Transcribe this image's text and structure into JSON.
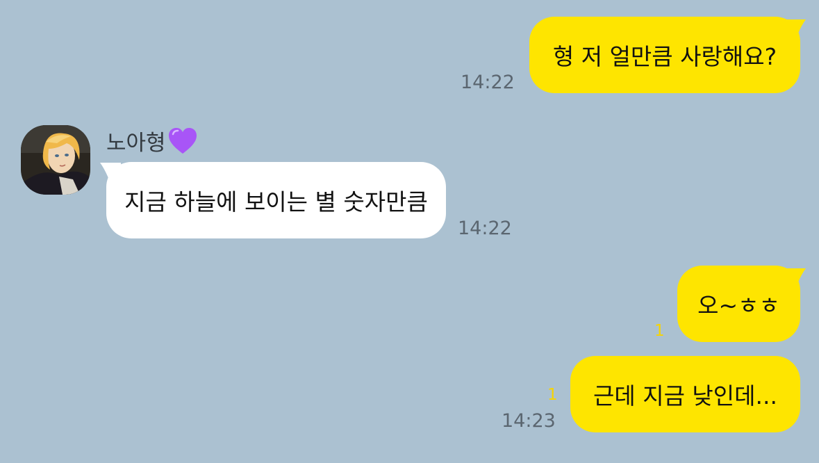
{
  "colors": {
    "background": "#abc1d1",
    "my_bubble": "#fee500",
    "their_bubble": "#ffffff",
    "timestamp": "#5b6670",
    "unread_count": "#f7d400",
    "heart": "#a855f7"
  },
  "messages": [
    {
      "side": "mine",
      "text": "형 저 얼만큼 사랑해요?",
      "time": "14:22",
      "unread": ""
    },
    {
      "side": "theirs",
      "sender": "노아형",
      "sender_icon": "purple-heart-icon",
      "text": "지금 하늘에 보이는 별 숫자만큼",
      "time": "14:22",
      "unread": ""
    },
    {
      "side": "mine",
      "text": "오~ㅎㅎ",
      "time": "",
      "unread": "1"
    },
    {
      "side": "mine",
      "text": "근데 지금 낮인데...",
      "time": "14:23",
      "unread": "1"
    }
  ]
}
